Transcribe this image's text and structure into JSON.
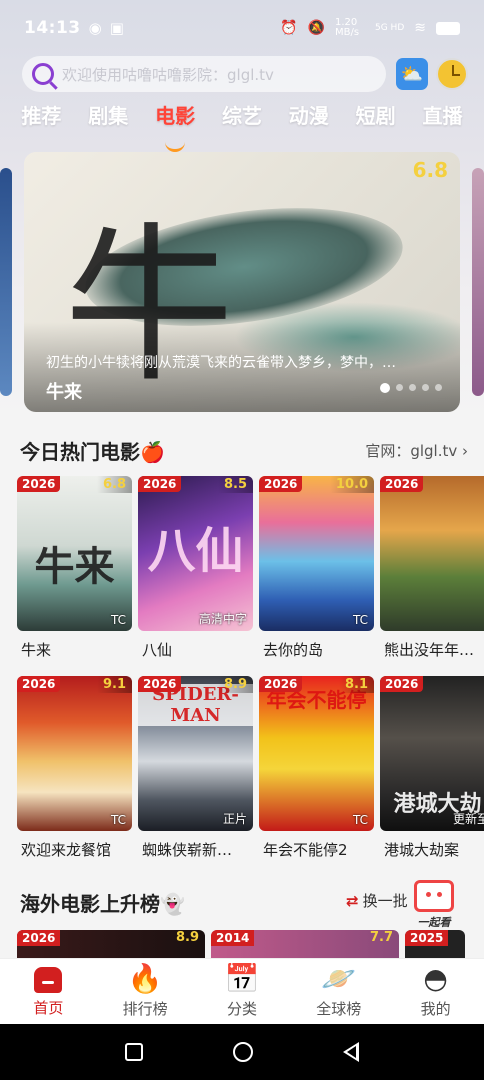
{
  "status_bar": {
    "time": "14:13",
    "network_speed": "1.20 MB/s",
    "signal": "5G HD"
  },
  "search": {
    "placeholder": "欢迎使用咕噜咕噜影院：glgl.tv"
  },
  "tabs": [
    {
      "label": "推荐",
      "active": false
    },
    {
      "label": "剧集",
      "active": false
    },
    {
      "label": "电影",
      "active": true
    },
    {
      "label": "综艺",
      "active": false
    },
    {
      "label": "动漫",
      "active": false
    },
    {
      "label": "短剧",
      "active": false
    },
    {
      "label": "直播",
      "active": false
    }
  ],
  "banner": {
    "title": "牛来",
    "rating": "6.8",
    "poster_text": "牛",
    "description": "初生的小牛犊将刚从荒漠飞来的云雀带入梦乡，梦中，…",
    "dots": 5,
    "active_dot": 0
  },
  "hot_section": {
    "heading": "今日热门电影🍎",
    "link": "官网：glgl.tv ›",
    "movies": [
      {
        "year": "2026",
        "score": "6.8",
        "tag": "TC",
        "name": "牛来",
        "poster_text": "牛来"
      },
      {
        "year": "2026",
        "score": "8.5",
        "tag": "高清中字",
        "name": "八仙",
        "poster_text": "八仙"
      },
      {
        "year": "2026",
        "score": "10.0",
        "tag": "TC",
        "name": "去你的岛",
        "poster_text": ""
      },
      {
        "year": "2026",
        "score": "",
        "tag": "",
        "name": "熊出没年年…",
        "poster_text": ""
      },
      {
        "year": "2026",
        "score": "9.1",
        "tag": "TC",
        "name": "欢迎来龙餐馆",
        "poster_text": ""
      },
      {
        "year": "2026",
        "score": "8.9",
        "tag": "正片",
        "name": "蜘蛛侠崭新…",
        "poster_text": "SPIDER-MAN"
      },
      {
        "year": "2026",
        "score": "8.1",
        "tag": "TC",
        "name": "年会不能停2",
        "poster_text": "年会不能停"
      },
      {
        "year": "2026",
        "score": "",
        "tag": "更新至",
        "name": "港城大劫案",
        "poster_text": "港城大劫"
      }
    ]
  },
  "overseas_section": {
    "heading": "海外电影上升榜👻",
    "refresh_label": "换一批",
    "refresh_icon": "⇄",
    "peek": [
      {
        "year": "2026",
        "score": "8.9"
      },
      {
        "year": "2014",
        "score": "7.7"
      },
      {
        "year": "2025",
        "score": ""
      }
    ]
  },
  "watch_together": {
    "label": "一起看"
  },
  "bottom_nav": [
    {
      "label": "首页",
      "icon": "home-icon",
      "active": true
    },
    {
      "label": "排行榜",
      "icon": "flame-icon",
      "active": false
    },
    {
      "label": "分类",
      "icon": "calendar-check-icon",
      "active": false
    },
    {
      "label": "全球榜",
      "icon": "planet-icon",
      "active": false
    },
    {
      "label": "我的",
      "icon": "profile-icon",
      "active": false
    }
  ],
  "colors": {
    "accent": "#d21f1f",
    "active_tab": "#ff4438",
    "score": "#f4d03f"
  }
}
